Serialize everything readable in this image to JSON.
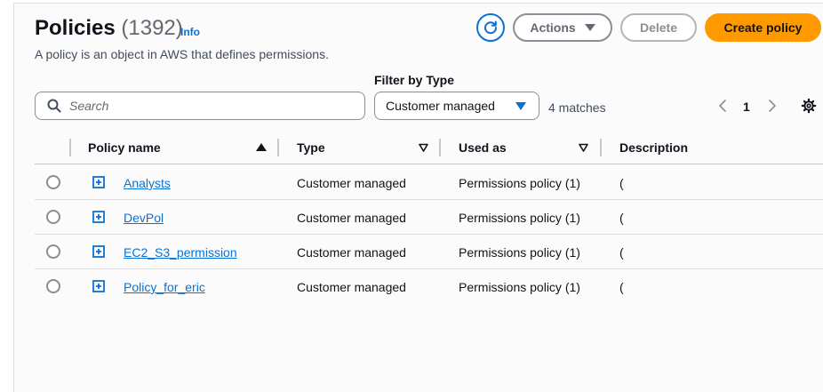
{
  "header": {
    "title": "Policies",
    "count": "(1392)",
    "info_label": "Info",
    "description": "A policy is an object in AWS that defines permissions."
  },
  "toolbar": {
    "actions_label": "Actions",
    "delete_label": "Delete",
    "create_label": "Create policy"
  },
  "filter": {
    "search_placeholder": "Search",
    "type_label": "Filter by Type",
    "type_selected": "Customer managed",
    "matches": "4 matches"
  },
  "pagination": {
    "current_page": "1"
  },
  "table": {
    "columns": [
      "Policy name",
      "Type",
      "Used as",
      "Description"
    ],
    "rows": [
      {
        "name": "Analysts",
        "type": "Customer managed",
        "used_as": "Permissions policy (1)",
        "description": "("
      },
      {
        "name": "DevPol",
        "type": "Customer managed",
        "used_as": "Permissions policy (1)",
        "description": "("
      },
      {
        "name": "EC2_S3_permission",
        "type": "Customer managed",
        "used_as": "Permissions policy (1)",
        "description": "("
      },
      {
        "name": "Policy_for_eric",
        "type": "Customer managed",
        "used_as": "Permissions policy (1)",
        "description": "("
      }
    ]
  },
  "colors": {
    "link": "#0972d3",
    "primary_button": "#ff9900",
    "text": "#0f141a",
    "border": "#8c8c94"
  },
  "icons": [
    "refresh-icon",
    "caret-down-icon",
    "search-icon",
    "chevron-left-icon",
    "chevron-right-icon",
    "settings-icon",
    "sort-ascending-icon",
    "sort-descending-icon",
    "expand-icon"
  ]
}
